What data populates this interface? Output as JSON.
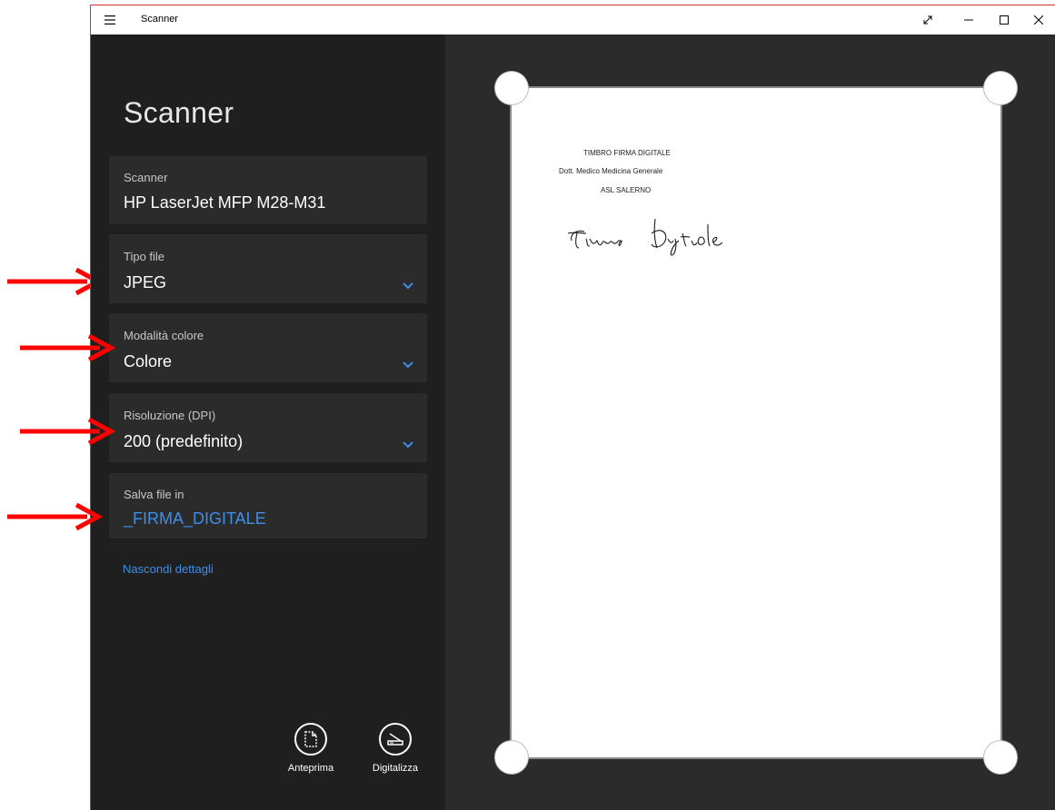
{
  "window": {
    "title": "Scanner"
  },
  "panel": {
    "title": "Scanner"
  },
  "fields": {
    "scanner": {
      "label": "Scanner",
      "value": "HP LaserJet MFP M28-M31"
    },
    "file_type": {
      "label": "Tipo file",
      "value": "JPEG"
    },
    "color_mode": {
      "label": "Modalità colore",
      "value": "Colore"
    },
    "resolution": {
      "label": "Risoluzione (DPI)",
      "value": "200 (predefinito)"
    },
    "save_to": {
      "label": "Salva file in",
      "value": "_FIRMA_DIGITALE"
    }
  },
  "hide_details": "Nascondi dettagli",
  "actions": {
    "preview": "Anteprima",
    "scan": "Digitalizza"
  },
  "document": {
    "line1": "TIMBRO FIRMA DIGITALE",
    "line2": "Dott. Medico Medicina Generale",
    "line3": "ASL SALERNO",
    "signature": "Firma Digitale"
  },
  "colors": {
    "accent": "#3e8fe8",
    "annotation_arrow": "#ff0000",
    "window_border": "#d13438"
  },
  "icons": [
    "hamburger-icon",
    "expand-icon",
    "minimize-icon",
    "maximize-icon",
    "close-icon",
    "chevron-down-icon",
    "preview-icon",
    "scan-icon"
  ]
}
